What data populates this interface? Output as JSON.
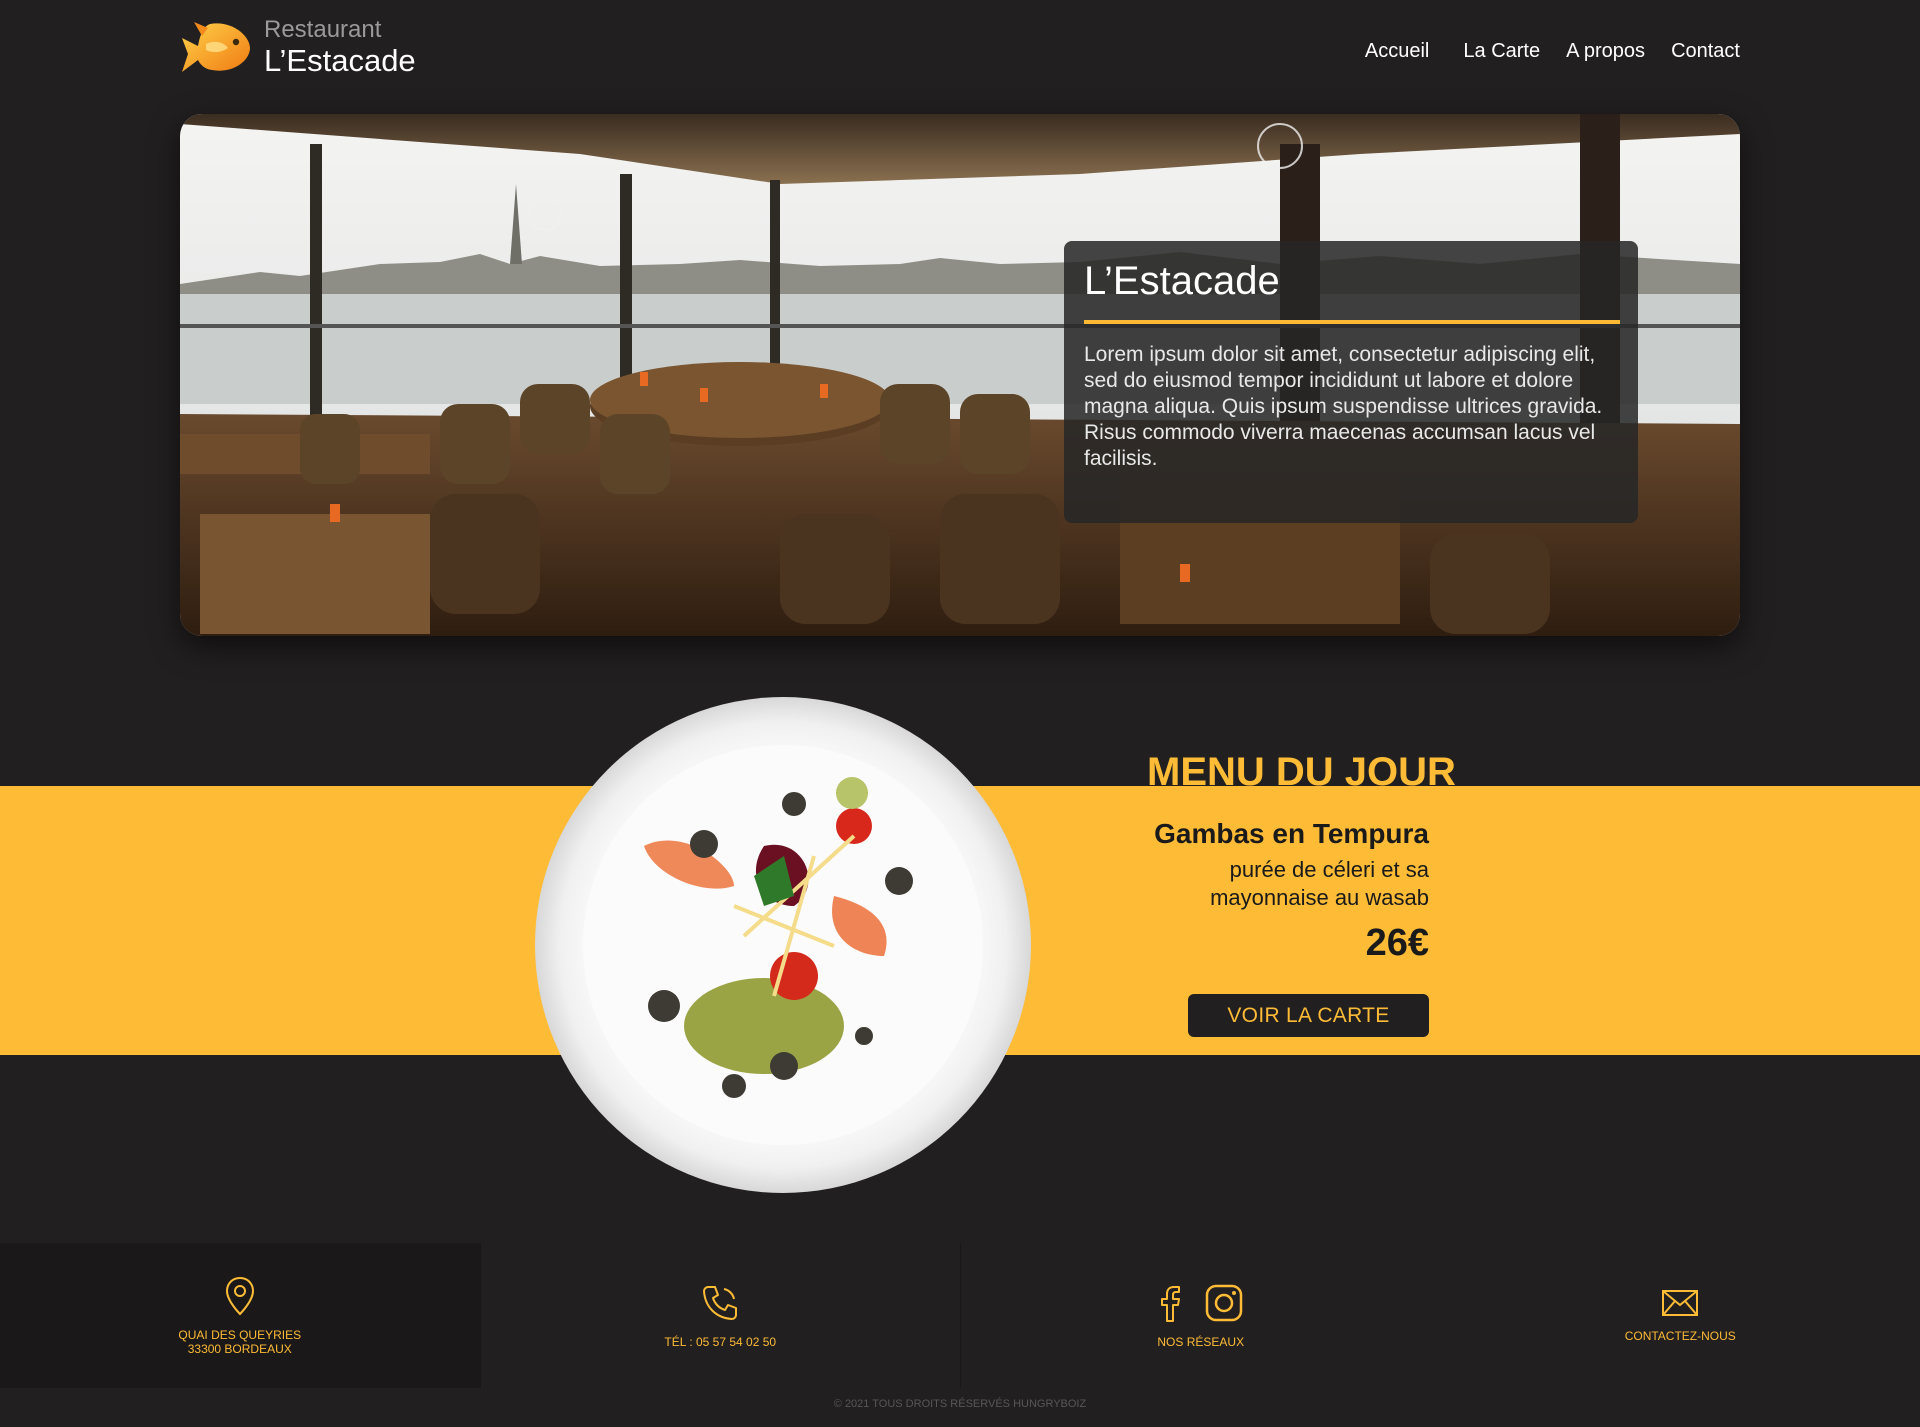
{
  "brand": {
    "subtitle": "Restaurant",
    "name": "L’Estacade"
  },
  "nav": [
    "Accueil",
    "La Carte",
    "A propos",
    "Contact"
  ],
  "hero": {
    "title": "L’Estacade",
    "text": "Lorem ipsum dolor sit amet, consectetur adipiscing elit, sed do eiusmod tempor incididunt ut labore et dolore magna aliqua. Quis ipsum suspendisse ultrices gravida. Risus commodo viverra maecenas accumsan lacus vel facilisis."
  },
  "menu": {
    "title": "MENU DU JOUR",
    "dish": "Gambas en Tempura",
    "description": "purée de céleri et sa mayonnaise au wasab",
    "price": "26€",
    "button": "VOIR LA CARTE"
  },
  "footer": {
    "address_line1": "QUAI DES QUEYRIES",
    "address_line2": "33300 BORDEAUX",
    "phone": "TÉL : 05 57 54 02 50",
    "social": "NOS RÉSEAUX",
    "contact": "CONTACTEZ-NOUS",
    "copyright": "© 2021 TOUS DROITS RÉSERVÉS HUNGRYBOIZ"
  },
  "colors": {
    "accent": "#fdbb36",
    "background": "#221f20"
  },
  "icons": [
    "location-pin-icon",
    "phone-icon",
    "facebook-icon",
    "instagram-icon",
    "mail-icon"
  ]
}
